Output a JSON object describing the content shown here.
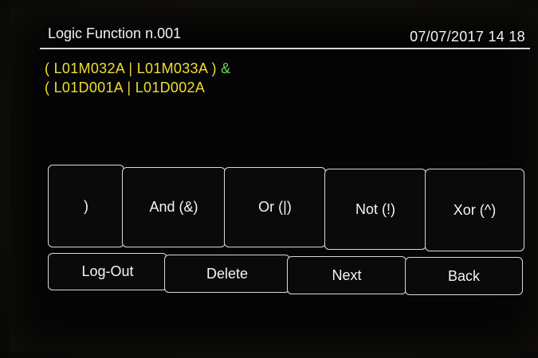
{
  "header": {
    "title": "Logic Function n.001",
    "datetime": "07/07/2017 14 18"
  },
  "expression": {
    "line1": {
      "open": "(",
      "term1": "L01M032A",
      "or": "|",
      "term2": "L01M033A",
      "close": ")",
      "and": "&"
    },
    "line2": {
      "open": "(",
      "term1": "L01D001A",
      "or": "|",
      "term2": "L01D002A"
    }
  },
  "operators": [
    ")",
    "And (&)",
    "Or (|)",
    "Not (!)",
    "Xor (^)"
  ],
  "nav": {
    "logout": "Log-Out",
    "delete": "Delete",
    "next": "Next",
    "back": "Back"
  }
}
